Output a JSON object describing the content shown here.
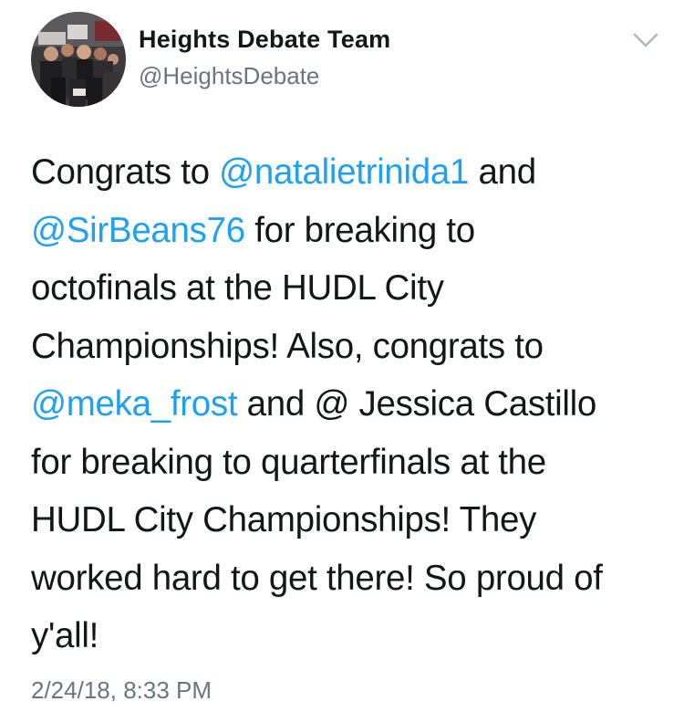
{
  "tweet": {
    "author": {
      "display_name": "Heights Debate Team",
      "handle": "@HeightsDebate",
      "avatar_icon": "team-photo-avatar"
    },
    "menu_icon": "chevron-down-icon",
    "text_lines": [
      {
        "parts": [
          "Congrats to ",
          "@natalietrinida1",
          " and"
        ]
      },
      {
        "parts": [
          "@SirBeans76",
          " for breaking to"
        ]
      },
      {
        "parts": [
          "octofinals at the HUDL City"
        ]
      },
      {
        "parts": [
          "Championships! Also, congrats to"
        ]
      },
      {
        "parts": [
          "@meka_frost",
          " and @ Jessica Castillo"
        ]
      },
      {
        "parts": [
          "for breaking to quarterfinals at the"
        ]
      },
      {
        "parts": [
          "HUDL City Championships! They"
        ]
      },
      {
        "parts": [
          "worked hard to get there! So proud of"
        ]
      },
      {
        "parts": [
          "y'all!"
        ]
      }
    ],
    "timestamp": "2/24/18, 8:33 PM"
  },
  "colors": {
    "mention": "#1da1f2",
    "text": "#14171a",
    "secondary": "#657786"
  }
}
